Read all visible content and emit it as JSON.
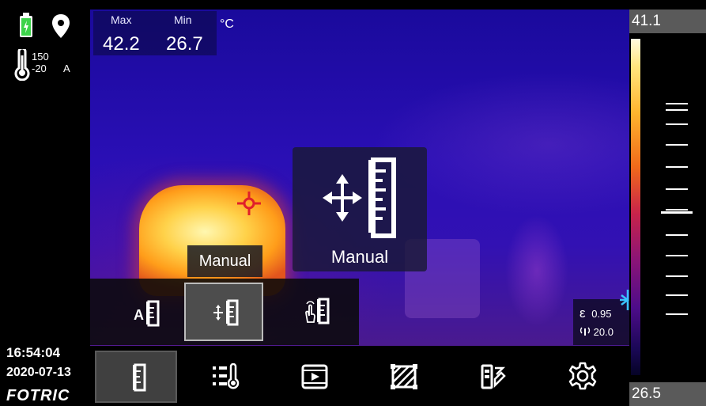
{
  "status": {
    "range_high": "150",
    "range_low": "-20",
    "range_mode": "A"
  },
  "clock": {
    "time": "16:54:04",
    "date": "2020-07-13"
  },
  "brand": {
    "logo_text": "FOTRIC"
  },
  "measurements": {
    "max_label": "Max",
    "max_value": "42.2",
    "min_label": "Min",
    "min_value": "26.7",
    "unit": "°C"
  },
  "level_mode": {
    "popup_label": "Manual",
    "tooltip_label": "Manual"
  },
  "submenu": {
    "items": [
      {
        "icon": "auto-level-icon",
        "glyph": "A",
        "selected": false
      },
      {
        "icon": "manual-level-icon",
        "selected": true
      },
      {
        "icon": "touch-level-icon",
        "selected": false
      }
    ]
  },
  "toolbar": {
    "items": [
      {
        "icon": "level-span-icon",
        "selected": true
      },
      {
        "icon": "measure-tools-icon",
        "selected": false
      },
      {
        "icon": "video-gallery-icon",
        "selected": false
      },
      {
        "icon": "image-fusion-icon",
        "selected": false
      },
      {
        "icon": "palette-icon",
        "selected": false
      },
      {
        "icon": "settings-gear-icon",
        "selected": false
      }
    ]
  },
  "params": {
    "emissivity_symbol": "ε",
    "emissivity": "0.95",
    "distance": "20.0"
  },
  "scale": {
    "top_value": "41.1",
    "bottom_value": "26.5"
  },
  "colors": {
    "battery": "#3cd34a",
    "cursor": "#e0202a",
    "accent_cyan": "#3ac4ff"
  }
}
